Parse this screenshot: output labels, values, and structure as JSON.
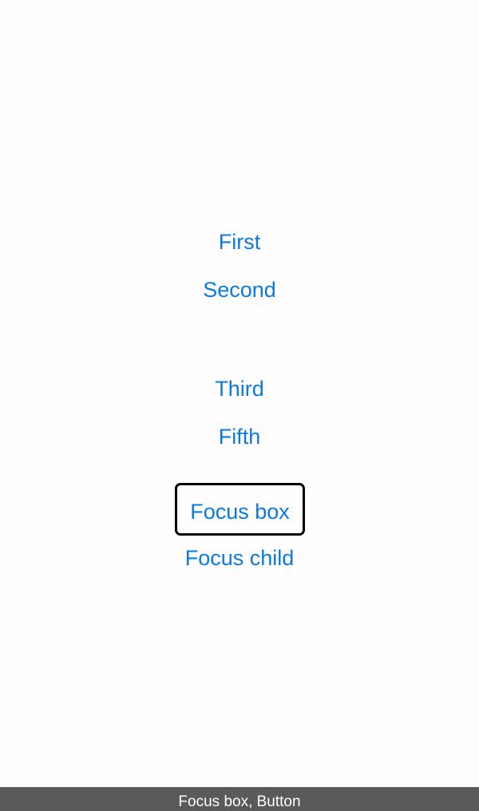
{
  "buttons": {
    "first": "First",
    "second": "Second",
    "third": "Third",
    "fifth": "Fifth",
    "focus_box": "Focus box",
    "focus_child": "Focus child"
  },
  "accessibility_caption": "Focus box, Button",
  "colors": {
    "link": "#0a7ae0",
    "focus_ring": "#000000",
    "caption_background": "#5a595b",
    "background": "#fffdfd"
  }
}
